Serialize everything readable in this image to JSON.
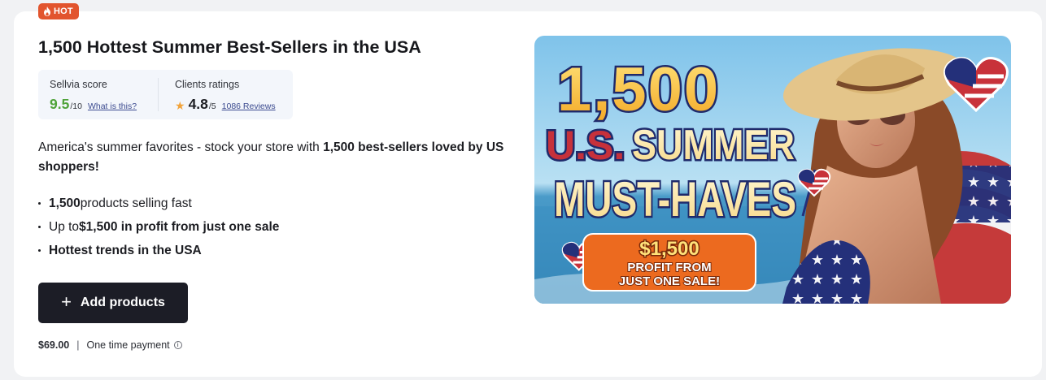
{
  "badge": {
    "label": "HOT",
    "icon": "fire-icon"
  },
  "product": {
    "title": "1,500 Hottest Summer Best-Sellers in the USA"
  },
  "score": {
    "sellvia_label": "Sellvia score",
    "sellvia_value": "9.5",
    "sellvia_denominator": "/10",
    "what_is_this": "What is this?",
    "ratings_label": "Clients ratings",
    "ratings_value": "4.8",
    "ratings_denominator": "/5",
    "reviews_link": "1086 Reviews",
    "star_icon": "star-icon"
  },
  "description": {
    "plain": "America's summer favorites - stock your store with ",
    "bold": "1,500 best-sellers loved by US shoppers!"
  },
  "bullets": [
    {
      "bold_pre": "1,500",
      "text": " products selling fast",
      "bold_post": ""
    },
    {
      "bold_pre": "",
      "text": "Up to ",
      "bold_post": "$1,500 in profit from just one sale"
    },
    {
      "bold_pre": "Hottest trends in the USA",
      "text": "",
      "bold_post": ""
    }
  ],
  "button": {
    "label": "Add products",
    "icon": "plus-icon"
  },
  "pricing": {
    "price": "$69.00",
    "separator": "|",
    "payment_type": "One time payment",
    "info_icon": "info-icon"
  },
  "promo_image": {
    "headline_1": "1,500",
    "headline_2a": "U.S.",
    "headline_2b": "SUMMER",
    "headline_3": "MUST-HAVES",
    "badge_line_1": "$1,500",
    "badge_line_2": "PROFIT FROM",
    "badge_line_3": "JUST ONE SALE!",
    "colors": {
      "yellow": "#f7c331",
      "navy": "#1f2a6b",
      "orange": "#ec6a1f",
      "sky": "#8ec9ec",
      "sea": "#3b8fc1"
    }
  },
  "colors": {
    "badge": "#e2552e",
    "score_green": "#4fa33a",
    "button": "#1c1d26",
    "link": "#3b4a8f",
    "star": "#f2a33a"
  }
}
